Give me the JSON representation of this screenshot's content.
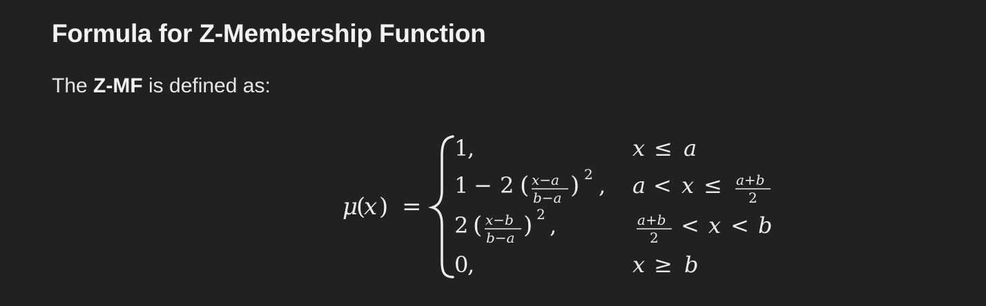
{
  "heading": "Formula for Z-Membership Function",
  "intro": {
    "prefix": "The ",
    "term": "Z-MF",
    "suffix": " is defined as:"
  },
  "formula": {
    "lhs": "μ(x)",
    "equals": "=",
    "cases": [
      {
        "expression": "1,",
        "condition": "x ≤ a"
      },
      {
        "expression": "1 − 2 ((x−a)/(b−a))², ",
        "condition": "a < x ≤ (a+b)/2"
      },
      {
        "expression": "2 ((x−b)/(b−a))², ",
        "condition": "(a+b)/2 < x < b"
      },
      {
        "expression": "0,",
        "condition": "x ≥ b"
      }
    ],
    "tokens": {
      "one": "1",
      "two": "2",
      "zero": "0",
      "comma": ",",
      "minus": "−",
      "x": "x",
      "a": "a",
      "b": "b",
      "le": "≤",
      "ge": "≥",
      "lt": "<",
      "x_minus_a": "x−a",
      "x_minus_b": "x−b",
      "b_minus_a": "b−a",
      "a_plus_b": "a+b",
      "sq": "2",
      "lparen": "(",
      "rparen": ")",
      "mu": "μ"
    }
  }
}
